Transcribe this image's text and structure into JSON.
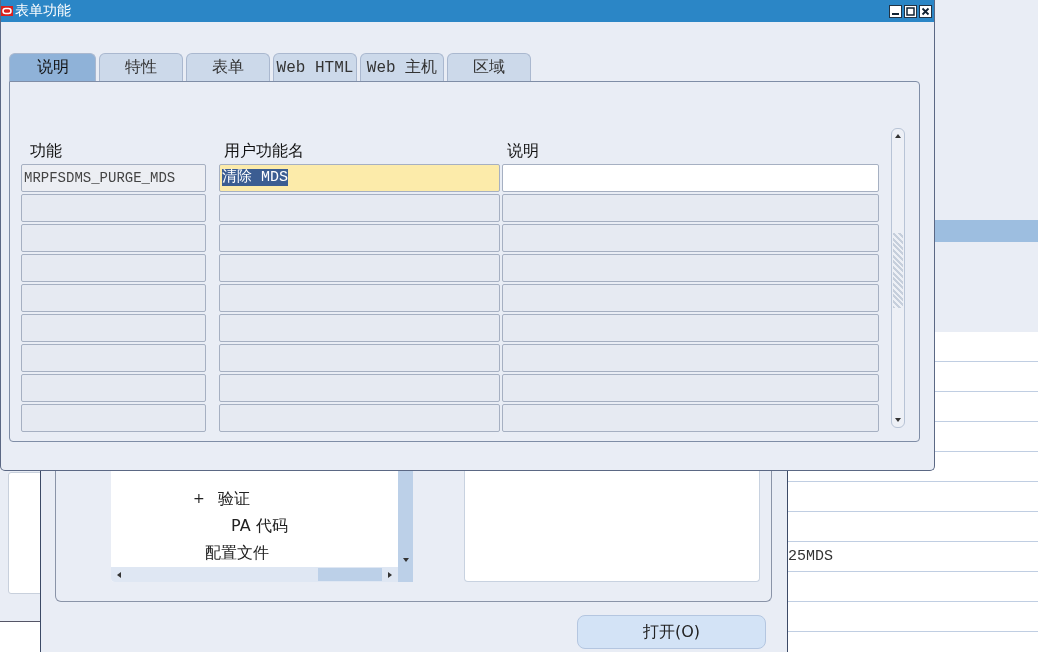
{
  "navigator": {
    "tree": [
      {
        "children": [
          {
            "expander": "+",
            "label": "验证",
            "children": [
              {
                "label": "PA 代码"
              }
            ]
          }
        ]
      },
      {
        "label": "配置文件"
      }
    ],
    "open_button": "打开(O)"
  },
  "records_window": {
    "rows": [
      {},
      {},
      {},
      {},
      {},
      {},
      {},
      {
        "text": "25MDS"
      },
      {},
      {}
    ]
  },
  "dialog": {
    "title": "表单功能",
    "tabs": [
      {
        "label": "说明",
        "selected": true
      },
      {
        "label": "特性",
        "selected": false
      },
      {
        "label": "表单",
        "selected": false
      },
      {
        "label": "Web HTML",
        "selected": false
      },
      {
        "label": "Web 主机",
        "selected": false
      },
      {
        "label": "区域",
        "selected": false
      }
    ],
    "table": {
      "columns": [
        "功能",
        "用户功能名",
        "说明"
      ],
      "rows": [
        {
          "function": "MRPFSDMS_PURGE_MDS",
          "user_function_name": "清除 MDS",
          "user_function_name_selected": true,
          "current": true
        }
      ]
    }
  }
}
